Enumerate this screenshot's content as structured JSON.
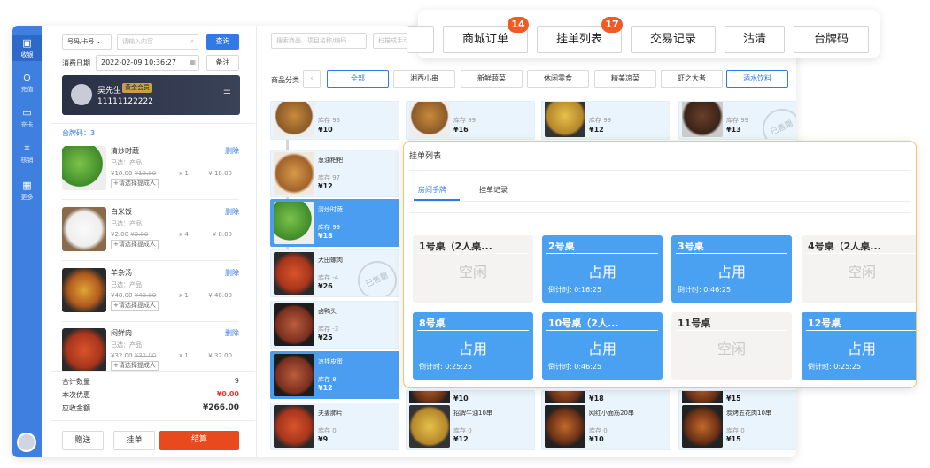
{
  "rail": [
    {
      "label": "收银",
      "icon": "cashier-icon"
    },
    {
      "label": "充值",
      "icon": "recharge-icon"
    },
    {
      "label": "充卡",
      "icon": "card-icon"
    },
    {
      "label": "核销",
      "icon": "scan-icon"
    },
    {
      "label": "更多",
      "icon": "grid-icon"
    }
  ],
  "order": {
    "search_mode": "号码/卡号",
    "search_placeholder": "请输入内容",
    "query_btn": "查询",
    "date_label": "消费日期",
    "date_value": "2022-02-09 10:36:27",
    "remark_btn": "备注",
    "member": {
      "name": "吴先生",
      "level": "黄金会员",
      "phone": "11111122222"
    },
    "table_no": "台牌码：3",
    "items": [
      {
        "name": "清炒时蔬",
        "del": "删除",
        "selected": "已选：产品",
        "orig": "¥18.00",
        "price": "¥18.00",
        "qty": "x 1",
        "amount": "¥ 18.00",
        "tag": "+请选择提成人",
        "img": "img-a"
      },
      {
        "name": "白米饭",
        "del": "删除",
        "selected": "已选：产品",
        "orig": "¥2.00",
        "price": "¥2.00",
        "qty": "x 4",
        "amount": "¥ 8.00",
        "tag": "+请选择提成人",
        "img": "img-b"
      },
      {
        "name": "羊杂汤",
        "del": "删除",
        "selected": "已选：产品",
        "orig": "¥48.00",
        "price": "¥48.00",
        "qty": "x 1",
        "amount": "¥ 48.00",
        "tag": "+请选择提成人",
        "img": "img-c"
      },
      {
        "name": "闷鲜肉",
        "del": "删除",
        "selected": "已选：产品",
        "orig": "¥32.00",
        "price": "¥32.00",
        "qty": "x 1",
        "amount": "¥ 32.00",
        "tag": "+请选择提成人",
        "img": "img-d"
      }
    ],
    "summary": {
      "count_label": "合计数量",
      "count": "9",
      "discount_label": "本次优惠",
      "discount": "¥0.00",
      "due_label": "应收金额",
      "due": "¥266.00"
    },
    "actions": {
      "gift": "赠送",
      "hang": "挂单",
      "checkout": "结算"
    }
  },
  "products": {
    "search_placeholder": "搜索商品、项目名称/编码",
    "scan_placeholder": "扫描成手动输",
    "category_label": "商品分类",
    "categories": [
      "全部",
      "湘西小串",
      "新鲜蔬菜",
      "休闲零食",
      "精美凉菜",
      "虾之大者",
      "酒水饮料"
    ],
    "cards": [
      {
        "name": "",
        "stock": "库存 95",
        "price": "¥10",
        "img": "img-e"
      },
      {
        "name": "",
        "stock": "库存 99",
        "price": "¥16",
        "img": "img-e"
      },
      {
        "name": "",
        "stock": "库存 99",
        "price": "¥12",
        "img": "img-f"
      },
      {
        "name": "",
        "stock": "库存 99",
        "price": "¥13",
        "img": "img-g"
      },
      {
        "name": "葱油粑粑",
        "stock": "库存 97",
        "price": "¥12",
        "img": "img-j"
      },
      {
        "name": "清炒时蔬",
        "stock": "库存 99",
        "price": "¥18",
        "img": "img-a"
      },
      {
        "name": "大田螺肉",
        "stock": "库存 -4",
        "price": "¥26",
        "img": "img-d"
      },
      {
        "name": "卤鸭头",
        "stock": "库存 -3",
        "price": "¥25",
        "img": "img-h"
      },
      {
        "name": "凉拌皮蛋",
        "stock": "库存 8",
        "price": "¥12",
        "img": "img-h"
      },
      {
        "name": "",
        "stock": "",
        "price": "¥10",
        "img": "img-i"
      },
      {
        "name": "",
        "stock": "",
        "price": "¥18",
        "img": "img-i"
      },
      {
        "name": "",
        "stock": "",
        "price": "¥15",
        "img": "img-i"
      },
      {
        "name": "夫妻肺片",
        "stock": "库存 0",
        "price": "¥9",
        "img": "img-d"
      },
      {
        "name": "招牌牛油10串",
        "stock": "库存 0",
        "price": "¥12",
        "img": "img-f"
      },
      {
        "name": "网红小面筋20串",
        "stock": "库存 0",
        "price": "¥10",
        "img": "img-i"
      },
      {
        "name": "炭烤五花肉10串",
        "stock": "库存 0",
        "price": "¥15",
        "img": "img-i"
      }
    ],
    "stamp": "已售罄"
  },
  "panel": {
    "title": "挂单列表",
    "tabs": [
      "房间手牌",
      "挂单记录"
    ],
    "tables": [
      {
        "name": "1号桌（2人桌...",
        "status": "空闲",
        "timer": "",
        "busy": false
      },
      {
        "name": "2号桌",
        "status": "占用",
        "timer": "倒计时:  0:16:25",
        "busy": true
      },
      {
        "name": "3号桌",
        "status": "占用",
        "timer": "倒计时:  0:46:25",
        "busy": true
      },
      {
        "name": "4号桌（2人桌...",
        "status": "空闲",
        "timer": "",
        "busy": false
      },
      {
        "name": "8号桌",
        "status": "占用",
        "timer": "倒计时:  0:25:25",
        "busy": true
      },
      {
        "name": "10号桌（2人...",
        "status": "占用",
        "timer": "倒计时:  0:46:25",
        "busy": true
      },
      {
        "name": "11号桌",
        "status": "空闲",
        "timer": "",
        "busy": false
      },
      {
        "name": "12号桌",
        "status": "占用",
        "timer": "倒计时:  0:25:25",
        "busy": true
      }
    ]
  },
  "topnav": {
    "buttons": [
      {
        "label": "商城订单",
        "count": "14"
      },
      {
        "label": "挂单列表",
        "count": "17"
      },
      {
        "label": "交易记录",
        "count": ""
      },
      {
        "label": "沽清",
        "count": ""
      },
      {
        "label": "台牌码",
        "count": ""
      }
    ]
  }
}
